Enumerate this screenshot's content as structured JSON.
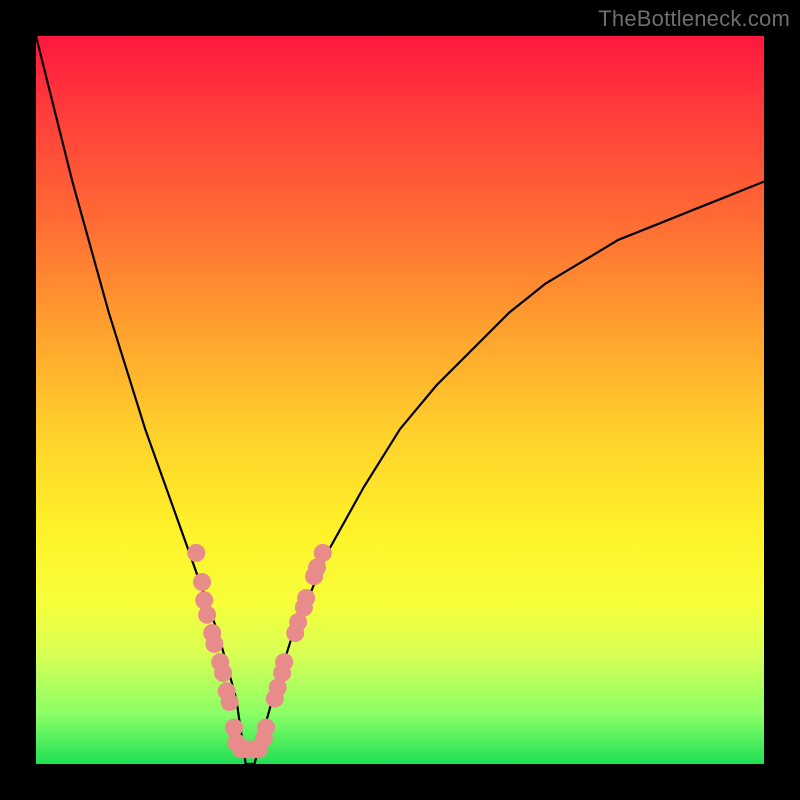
{
  "watermark": "TheBottleneck.com",
  "chart_data": {
    "type": "line",
    "title": "",
    "xlabel": "",
    "ylabel": "",
    "xlim": [
      0,
      100
    ],
    "ylim": [
      0,
      100
    ],
    "series": [
      {
        "name": "curve",
        "x": [
          0,
          5,
          10,
          15,
          20,
          22.5,
          25,
          27.5,
          28.8,
          30,
          32.5,
          35,
          40,
          45,
          50,
          55,
          60,
          65,
          70,
          75,
          80,
          85,
          90,
          95,
          100
        ],
        "y": [
          100,
          80,
          62,
          46,
          32,
          25,
          18,
          9,
          0,
          0,
          9,
          17,
          29,
          38,
          46,
          52,
          57,
          62,
          66,
          69,
          72,
          74,
          76,
          78,
          80
        ]
      }
    ],
    "v_notch_scatter": {
      "name": "dots",
      "color": "#e88b8b",
      "radius_px": 9,
      "points": [
        {
          "x": 22.0,
          "y": 29.0
        },
        {
          "x": 22.8,
          "y": 25.0
        },
        {
          "x": 23.1,
          "y": 22.5
        },
        {
          "x": 23.5,
          "y": 20.5
        },
        {
          "x": 24.2,
          "y": 18.0
        },
        {
          "x": 24.5,
          "y": 16.5
        },
        {
          "x": 25.3,
          "y": 14.0
        },
        {
          "x": 25.7,
          "y": 12.5
        },
        {
          "x": 26.2,
          "y": 10.0
        },
        {
          "x": 26.6,
          "y": 8.5
        },
        {
          "x": 27.2,
          "y": 5.0
        },
        {
          "x": 27.5,
          "y": 3.0
        },
        {
          "x": 28.2,
          "y": 2.0
        },
        {
          "x": 29.0,
          "y": 2.0
        },
        {
          "x": 29.8,
          "y": 2.0
        },
        {
          "x": 30.6,
          "y": 2.0
        },
        {
          "x": 31.3,
          "y": 3.5
        },
        {
          "x": 31.6,
          "y": 5.0
        },
        {
          "x": 32.8,
          "y": 9.0
        },
        {
          "x": 33.2,
          "y": 10.5
        },
        {
          "x": 33.8,
          "y": 12.5
        },
        {
          "x": 34.1,
          "y": 14.0
        },
        {
          "x": 35.6,
          "y": 18.0
        },
        {
          "x": 36.0,
          "y": 19.5
        },
        {
          "x": 36.8,
          "y": 21.5
        },
        {
          "x": 37.1,
          "y": 22.8
        },
        {
          "x": 38.2,
          "y": 25.8
        },
        {
          "x": 38.6,
          "y": 27.0
        },
        {
          "x": 39.4,
          "y": 29.0
        }
      ]
    },
    "gradient_stops": [
      {
        "pos": 0.0,
        "color": "#ff173e"
      },
      {
        "pos": 0.5,
        "color": "#ffd22b"
      },
      {
        "pos": 1.0,
        "color": "#20e055"
      }
    ]
  }
}
